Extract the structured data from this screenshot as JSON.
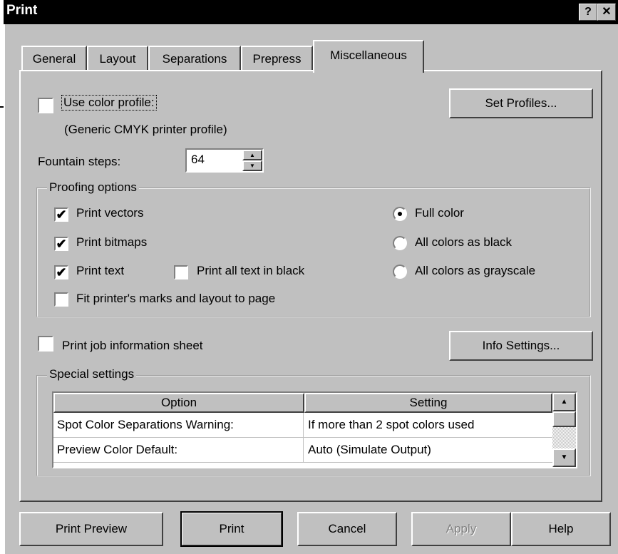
{
  "window": {
    "title": "Print",
    "help_btn": "?",
    "close_btn": "✕"
  },
  "tabs": [
    {
      "label": "General"
    },
    {
      "label": "Layout"
    },
    {
      "label": "Separations"
    },
    {
      "label": "Prepress"
    },
    {
      "label": "Miscellaneous"
    }
  ],
  "color_profile": {
    "label": "Use color profile:",
    "profile_name": "(Generic CMYK printer profile)",
    "checked": false,
    "set_profiles_button": "Set Profiles..."
  },
  "fountain_steps": {
    "label": "Fountain steps:",
    "value": "64"
  },
  "proofing": {
    "legend": "Proofing options",
    "print_vectors": "Print vectors",
    "print_bitmaps": "Print bitmaps",
    "print_text": "Print text",
    "print_all_text_black": "Print all text in black",
    "fit_marks": "Fit printer's marks and layout to page",
    "full_color": "Full color",
    "all_black": "All colors as black",
    "all_grayscale": "All colors as grayscale"
  },
  "job_info": {
    "label": "Print job information sheet",
    "button": "Info Settings..."
  },
  "special": {
    "legend": "Special settings",
    "columns": [
      "Option",
      "Setting"
    ],
    "rows": [
      [
        "Spot Color Separations Warning:",
        "If more than 2 spot colors used"
      ],
      [
        "Preview Color Default:",
        "Auto (Simulate Output)"
      ]
    ]
  },
  "buttons": {
    "print_preview": "Print Preview",
    "print": "Print",
    "cancel": "Cancel",
    "apply": "Apply",
    "help": "Help"
  },
  "icons": {
    "scroll_up": "▲",
    "scroll_down": "▼",
    "spin_up": "▲",
    "spin_down": "▼",
    "check": "✔"
  }
}
